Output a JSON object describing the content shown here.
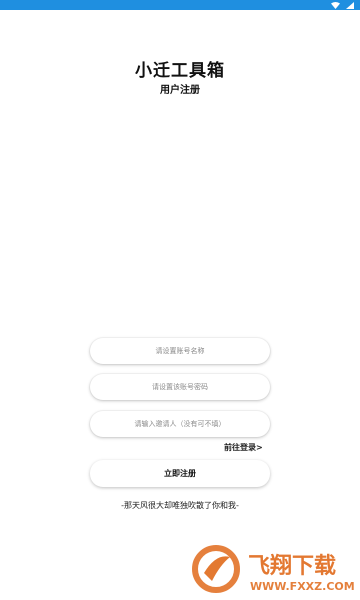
{
  "status_bar": {
    "background": "#1f8fe0",
    "icons": [
      "wifi-icon",
      "signal-icon"
    ]
  },
  "header": {
    "app_title": "小迁工具箱",
    "subtitle": "用户注册"
  },
  "form": {
    "username_placeholder": "请设置账号名称",
    "password_placeholder": "请设置该账号密码",
    "invite_placeholder": "请输入邀请人（没有可不填）",
    "login_link": "前往登录>",
    "register_button": "立即注册"
  },
  "footer": {
    "quote": "-那天风很大却唯独吹散了你和我-"
  },
  "watermark": {
    "brand_text": "飞翔下载",
    "url_text": "WWW.FXXZ.COM",
    "color": "#e06a1b"
  }
}
